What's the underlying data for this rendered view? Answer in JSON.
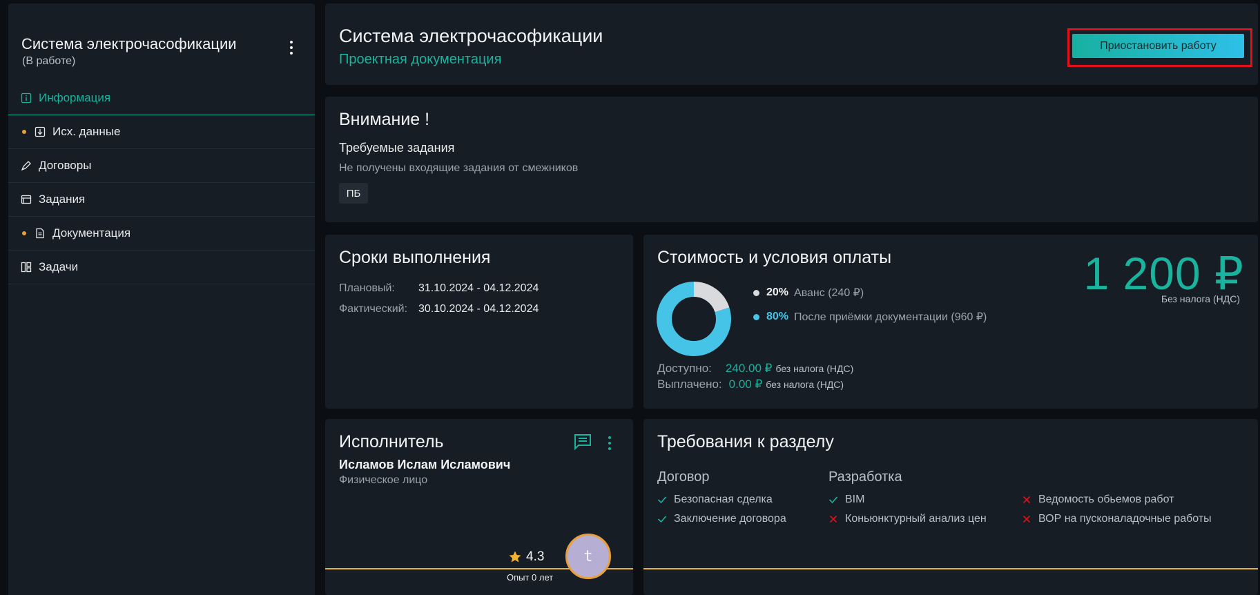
{
  "colors": {
    "accent": "#19b39e",
    "warning": "#e8a13a",
    "danger": "#e3101c",
    "avance": "#d9dadd",
    "after_accept": "#46c4e8"
  },
  "sidebar": {
    "title": "Система электрочасофикации",
    "status": "(В работе)",
    "items": [
      {
        "label": "Информация",
        "icon": "info-icon",
        "active": true,
        "dot": false
      },
      {
        "label": "Исх. данные",
        "icon": "download-icon",
        "active": false,
        "dot": true
      },
      {
        "label": "Договоры",
        "icon": "pen-icon",
        "active": false,
        "dot": false
      },
      {
        "label": "Задания",
        "icon": "window-icon",
        "active": false,
        "dot": false
      },
      {
        "label": "Документация",
        "icon": "document-icon",
        "active": false,
        "dot": true
      },
      {
        "label": "Задачи",
        "icon": "board-icon",
        "active": false,
        "dot": false
      }
    ]
  },
  "header": {
    "title": "Система электрочасофикации",
    "subtitle": "Проектная документация",
    "pause_label": "Приостановить работу"
  },
  "attention": {
    "title": "Внимание !",
    "subtitle": "Требуемые задания",
    "text": "Не получены входящие задания от смежников",
    "tag": "ПБ"
  },
  "deadlines": {
    "title": "Сроки выполнения",
    "planned_label": "Плановый:",
    "planned_value": "31.10.2024 - 04.12.2024",
    "actual_label": "Фактический:",
    "actual_value": "30.10.2024 - 04.12.2024"
  },
  "cost": {
    "title": "Стоимость и условия оплаты",
    "price": "1 200 ₽",
    "price_note": "Без налога (НДС)",
    "legend": [
      {
        "percent": "20%",
        "desc": "Аванс (240 ₽)",
        "value": 20
      },
      {
        "percent": "80%",
        "desc": "После приёмки документации (960 ₽)",
        "value": 80
      }
    ],
    "available_label": "Доступно:",
    "available_amount": "240.00 ₽",
    "available_tax": "без налога (НДС)",
    "paid_label": "Выплачено:",
    "paid_amount": "0.00 ₽",
    "paid_tax": "без налога (НДС)"
  },
  "executor": {
    "title": "Исполнитель",
    "name": "Исламов Ислам Исламович",
    "type": "Физическое лицо",
    "rating": "4.3",
    "experience": "Опыт 0 лет",
    "avatar_letter": "t"
  },
  "requirements": {
    "title": "Требования к разделу",
    "contract_title": "Договор",
    "development_title": "Разработка",
    "contract_items": [
      {
        "label": "Безопасная сделка",
        "ok": true
      },
      {
        "label": "Заключение договора",
        "ok": true
      }
    ],
    "development_items": [
      {
        "label": "BIM",
        "ok": true
      },
      {
        "label": "Коньюнктурный анализ цен",
        "ok": false
      }
    ],
    "extra_items": [
      {
        "label": "Ведомость обьемов работ",
        "ok": false
      },
      {
        "label": "ВОР на пусконаладочные работы",
        "ok": false
      }
    ]
  }
}
